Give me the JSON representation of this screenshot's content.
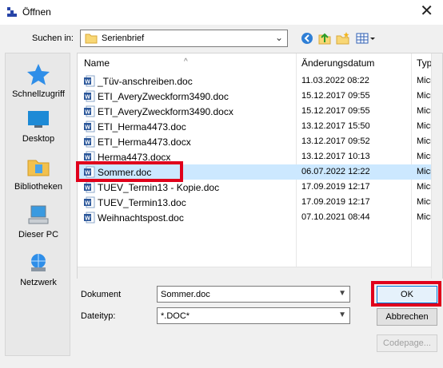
{
  "window": {
    "title": "Öffnen",
    "close_glyph": "✕"
  },
  "lookin": {
    "label": "Suchen in:",
    "value": "Serienbrief",
    "icon": "folder-icon"
  },
  "toolbar": [
    "back-icon",
    "up-folder-icon",
    "new-folder-icon",
    "view-menu-icon"
  ],
  "places": [
    {
      "label": "Schnellzugriff",
      "icon": "star-icon"
    },
    {
      "label": "Desktop",
      "icon": "desktop-icon"
    },
    {
      "label": "Bibliotheken",
      "icon": "libraries-icon"
    },
    {
      "label": "Dieser PC",
      "icon": "computer-icon"
    },
    {
      "label": "Netzwerk",
      "icon": "network-icon"
    }
  ],
  "columns": {
    "name": "Name",
    "date": "Änderungsdatum",
    "type": "Typ"
  },
  "files": [
    {
      "name": "_Tüv-anschreiben.doc",
      "date": "11.03.2022 08:22",
      "type": "Micro"
    },
    {
      "name": "ETI_AveryZweckform3490.doc",
      "date": "15.12.2017 09:55",
      "type": "Micro"
    },
    {
      "name": "ETI_AveryZweckform3490.docx",
      "date": "15.12.2017 09:55",
      "type": "Micro"
    },
    {
      "name": "ETI_Herma4473.doc",
      "date": "13.12.2017 15:50",
      "type": "Micro"
    },
    {
      "name": "ETI_Herma4473.docx",
      "date": "13.12.2017 09:52",
      "type": "Micro"
    },
    {
      "name": "Herma4473.docx",
      "date": "13.12.2017 10:13",
      "type": "Micro"
    },
    {
      "name": "Sommer.doc",
      "date": "06.07.2022 12:22",
      "type": "Micro",
      "selected": true
    },
    {
      "name": "TUEV_Termin13 - Kopie.doc",
      "date": "17.09.2019 12:17",
      "type": "Micro"
    },
    {
      "name": "TUEV_Termin13.doc",
      "date": "17.09.2019 12:17",
      "type": "Micro"
    },
    {
      "name": "Weihnachtspost.doc",
      "date": "07.10.2021 08:44",
      "type": "Micro"
    }
  ],
  "form": {
    "document_label": "Dokument",
    "document_value": "Sommer.doc",
    "filetype_label": "Dateityp:",
    "filetype_value": "*.DOC*"
  },
  "buttons": {
    "ok": "OK",
    "cancel": "Abbrechen",
    "codepage": "Codepage..."
  },
  "colors": {
    "selection": "#cce8ff",
    "highlight": "#e0001b",
    "word_blue": "#2b579a"
  }
}
